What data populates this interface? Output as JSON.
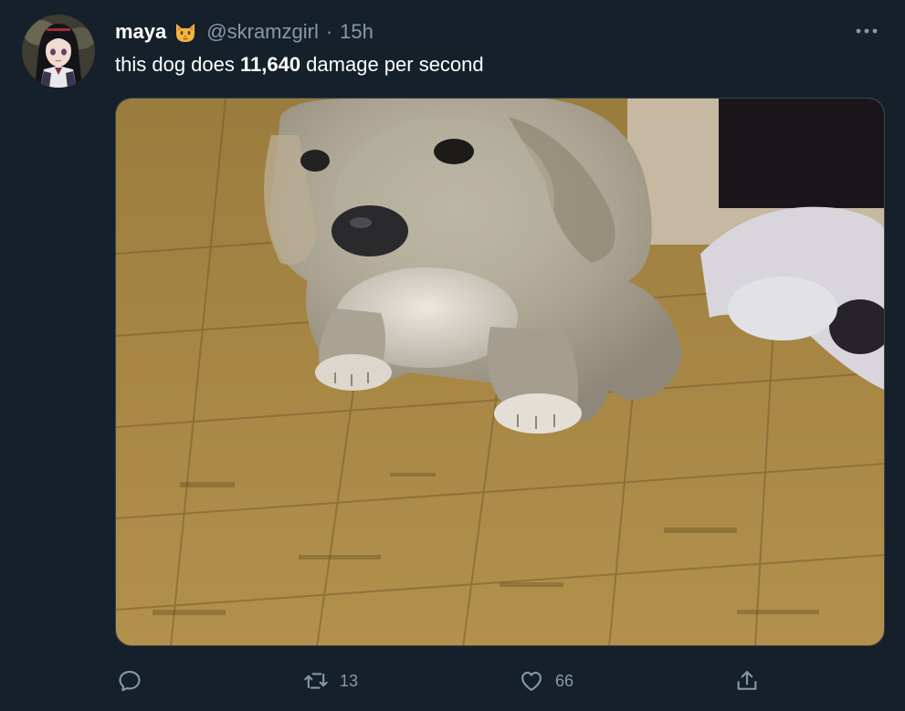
{
  "tweet": {
    "display_name": "maya",
    "name_emoji": "cat-face-emoji",
    "handle": "@skramzgirl",
    "separator": "·",
    "time": "15h",
    "text_before": "this dog does ",
    "text_bold": "11,640",
    "text_after": " damage per second",
    "media_alt": "photo of a puppy on a wooden floor",
    "more_icon": "more-horizontal-icon"
  },
  "actions": {
    "reply": {
      "icon": "reply-icon",
      "count": ""
    },
    "retweet": {
      "icon": "retweet-icon",
      "count": "13"
    },
    "like": {
      "icon": "heart-icon",
      "count": "66"
    },
    "share": {
      "icon": "share-icon",
      "count": ""
    }
  },
  "colors": {
    "background": "#15202b",
    "text_primary": "#ffffff",
    "text_secondary": "#8899a6",
    "border": "#38444d"
  }
}
